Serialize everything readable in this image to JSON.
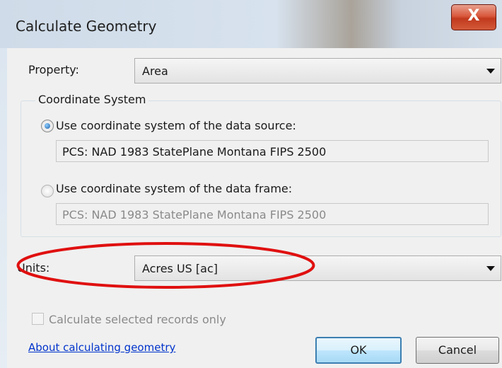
{
  "window": {
    "title": "Calculate Geometry",
    "close_glyph": "X"
  },
  "property": {
    "label": "Property:",
    "value": "Area"
  },
  "coordinate_system": {
    "group_label": "Coordinate System",
    "source_option": {
      "label": "Use coordinate system of the data source:",
      "selected": true,
      "value": "PCS: NAD 1983 StatePlane Montana FIPS 2500"
    },
    "frame_option": {
      "label": "Use coordinate system of the data frame:",
      "selected": false,
      "value": "PCS: NAD 1983 StatePlane Montana FIPS 2500"
    }
  },
  "units": {
    "label": "Units:",
    "value": "Acres US [ac]"
  },
  "selected_only": {
    "label": "Calculate selected records only",
    "checked": false,
    "enabled": false
  },
  "footer": {
    "help_link": "About calculating geometry",
    "ok": "OK",
    "cancel": "Cancel"
  },
  "colors": {
    "annotation_ellipse": "#e01010",
    "close_button": "#c9452a",
    "link": "#0033cc"
  },
  "icons": {
    "close": "close-icon",
    "dropdown": "chevron-down-icon"
  }
}
